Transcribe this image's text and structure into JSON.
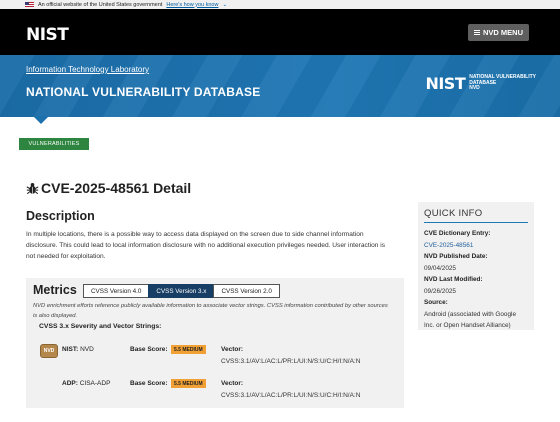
{
  "gov_banner": {
    "text": "An official website of the United States government",
    "link": "Here's how you know"
  },
  "header": {
    "logo": "NIST",
    "menu_label": "NVD MENU"
  },
  "band": {
    "itl_link": "Information Technology Laboratory",
    "title": "NATIONAL VULNERABILITY DATABASE",
    "logo_big": "NIST",
    "logo_line1": "NATIONAL VULNERABILITY",
    "logo_line2": "DATABASE",
    "logo_line3": "NVD"
  },
  "tab_label": "VULNERABILITIES",
  "cve": {
    "title": "CVE-2025-48561 Detail",
    "description_heading": "Description",
    "description": "In multiple locations, there is a possible way to access data displayed on the screen due to side channel information disclosure. This could lead to local information disclosure with no additional execution privileges needed. User interaction is not needed for exploitation."
  },
  "quick_info": {
    "title": "QUICK INFO",
    "dict_label": "CVE Dictionary Entry:",
    "dict_value": "CVE-2025-48561",
    "published_label": "NVD Published Date:",
    "published_value": "09/04/2025",
    "modified_label": "NVD Last Modified:",
    "modified_value": "09/26/2025",
    "source_label": "Source:",
    "source_value": "Android (associated with Google Inc. or Open Handset Alliance)"
  },
  "metrics": {
    "heading": "Metrics",
    "tabs": [
      "CVSS Version 4.0",
      "CVSS Version 3.x",
      "CVSS Version 2.0"
    ],
    "active_tab": "CVSS Version 3.x",
    "note": "NVD enrichment efforts reference publicly available information to associate vector strings. CVSS information contributed by other sources is also displayed.",
    "severity_heading": "CVSS 3.x Severity and Vector Strings:",
    "rows": [
      {
        "badge": "NVD",
        "source_label": "NIST:",
        "source": "NVD",
        "base_label": "Base Score:",
        "score": "5.5 MEDIUM",
        "vector_label": "Vector:",
        "vector": "CVSS:3.1/AV:L/AC:L/PR:L/UI:N/S:U/C:H/I:N/A:N"
      },
      {
        "source_label": "ADP:",
        "source": "CISA-ADP",
        "base_label": "Base Score:",
        "score": "5.5 MEDIUM",
        "vector_label": "Vector:",
        "vector": "CVSS:3.1/AV:L/AC:L/PR:L/UI:N/S:U/C:H/I:N/A:N"
      }
    ]
  },
  "colors": {
    "blue_band": "#1f77b4",
    "vuln_tab": "#2e8540",
    "active_tab": "#173e64",
    "medium_badge": "#f0a034"
  }
}
